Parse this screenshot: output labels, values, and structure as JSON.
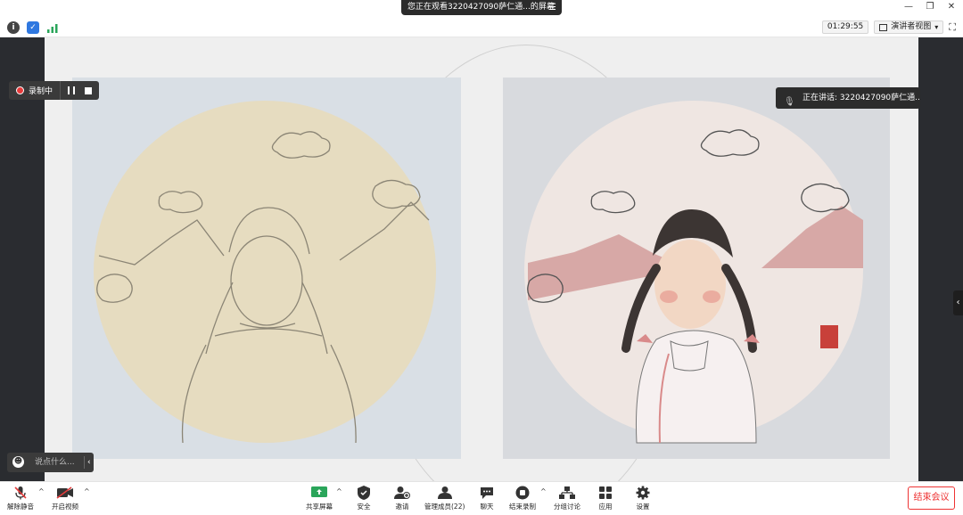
{
  "title_bar": {
    "title": "您正在观看3220427090萨仁通...的屏幕",
    "menu_glyph": "☰",
    "minimize": "—",
    "restore": "❐",
    "close": "✕"
  },
  "toolbar": {
    "info_icon": "info-icon",
    "shield_icon": "shield-icon",
    "signal_icon": "signal-icon",
    "timer": "01:29:55",
    "view_label": "演讲者视图",
    "view_caret": "▾",
    "fullscreen_icon": "⛶"
  },
  "recording": {
    "label": "录制中"
  },
  "speaker": {
    "label": "正在讲话: 3220427090萨仁通..."
  },
  "chat_input": {
    "placeholder": "说点什么...",
    "chevron": "‹"
  },
  "collapse_tab": {
    "glyph": "‹"
  },
  "bottom_bar": {
    "unmute": "解除静音",
    "start_video": "开启视频",
    "share_screen": "共享屏幕",
    "security": "安全",
    "invite": "邀请",
    "participants": "管理成员(22)",
    "chat": "聊天",
    "end_recording": "结束录制",
    "breakout": "分组讨论",
    "apps": "应用",
    "settings": "设置",
    "end_meeting": "结束会议",
    "caret": "^"
  },
  "colors": {
    "accent_red": "#e33b3b",
    "share_green": "#2aa55a",
    "dark_panel": "#2a2c30"
  }
}
